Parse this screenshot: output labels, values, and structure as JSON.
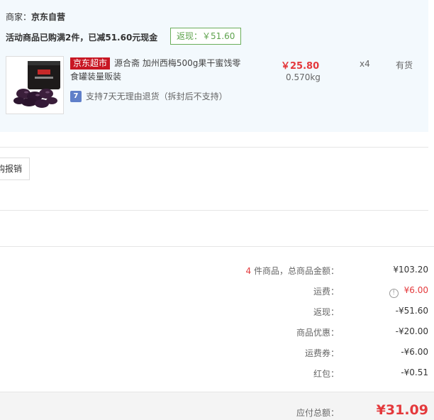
{
  "merchant": {
    "label": "商家：",
    "name": "京东自营"
  },
  "promo": {
    "text": "活动商品已购满2件，已减51.60元现金",
    "tag": "返现：￥51.60"
  },
  "product": {
    "badge": "京东超市",
    "title": "源合斋 加州西梅500g果干蜜饯零食罐装量贩装",
    "return_icon_text": "7",
    "return_text": "支持7天无理由退货（拆封后不支持）",
    "price": "￥25.80",
    "weight": "0.570kg",
    "quantity": "x4",
    "stock": "有货"
  },
  "invoice": {
    "button_label": "购报销"
  },
  "summary": {
    "count": "4",
    "count_label": " 件商品，总商品金额：",
    "goods_total": "¥103.20",
    "shipping_label": "运费：",
    "shipping_value": "¥6.00",
    "rebate_label": "返现：",
    "rebate_value": "-¥51.60",
    "discount_label": "商品优惠：",
    "discount_value": "-¥20.00",
    "shipping_coupon_label": "运费券：",
    "shipping_coupon_value": "-¥6.00",
    "redpacket_label": "红包：",
    "redpacket_value": "-¥0.51"
  },
  "total": {
    "label": "应付总额：",
    "value": "¥31.09"
  },
  "colors": {
    "accent_red": "#e4393c",
    "jd_red": "#c81623",
    "promo_green": "#5fa34e",
    "panel_bg": "#f3f9fd"
  }
}
